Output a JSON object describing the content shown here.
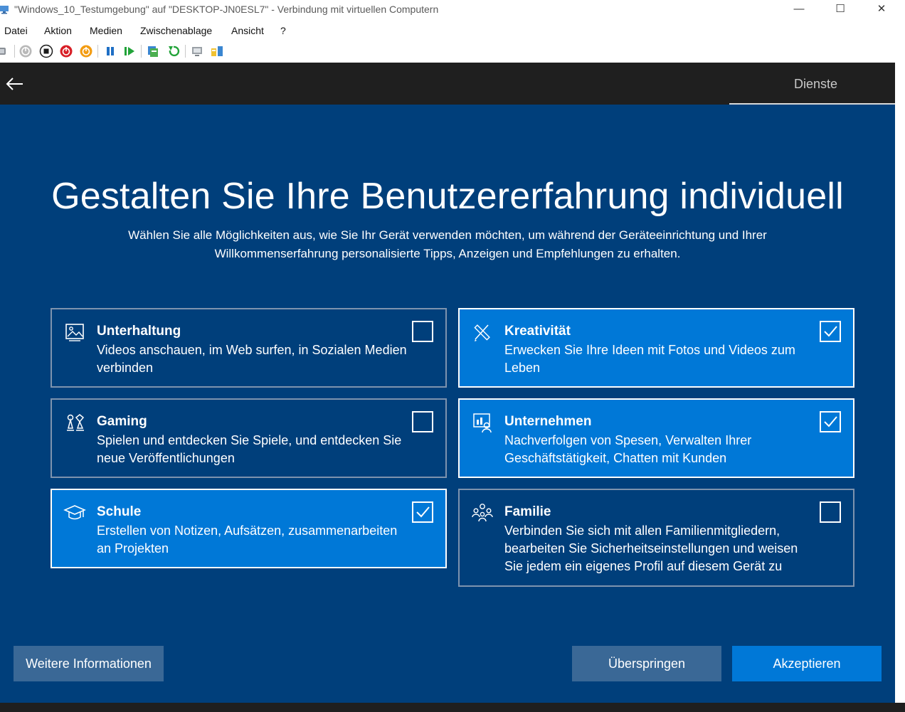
{
  "window": {
    "title": "\"Windows_10_Testumgebung\" auf \"DESKTOP-JN0ESL7\" - Verbindung mit virtuellen Computern",
    "minimize_glyph": "—",
    "maximize_glyph": "☐",
    "close_glyph": "✕"
  },
  "menu": [
    "Datei",
    "Aktion",
    "Medien",
    "Zwischenablage",
    "Ansicht",
    "?"
  ],
  "toolbar": {
    "icons": [
      "ctrl-alt-del-icon",
      "start-icon",
      "turn-off-icon",
      "shut-down-icon",
      "save-icon",
      "pause-icon",
      "resume-icon",
      "checkpoint-icon",
      "revert-icon",
      "enhanced-session-icon",
      "share-icon"
    ]
  },
  "oobe": {
    "back_icon": "back-arrow-icon",
    "stage_label": "Dienste",
    "heading": "Gestalten Sie Ihre Benutzererfahrung individuell",
    "subtitle": "Wählen Sie alle Möglichkeiten aus, wie Sie Ihr Gerät verwenden möchten, um während der Geräteeinrichtung und Ihrer Willkommenserfahrung personalisierte Tipps, Anzeigen und Empfehlungen zu erhalten.",
    "cards": [
      {
        "title": "Unterhaltung",
        "description": "Videos anschauen, im Web surfen, in Sozialen Medien verbinden",
        "checked": false,
        "icon": "picture-icon"
      },
      {
        "title": "Kreativität",
        "description": "Erwecken Sie Ihre Ideen mit Fotos und Videos zum Leben",
        "checked": true,
        "icon": "pen-ruler-icon"
      },
      {
        "title": "Gaming",
        "description": "Spielen und entdecken Sie Spiele, und entdecken Sie neue Veröffentlichungen",
        "checked": false,
        "icon": "game-pieces-icon"
      },
      {
        "title": "Unternehmen",
        "description": "Nachverfolgen von Spesen, Verwalten Ihrer Geschäftstätigkeit, Chatten mit Kunden",
        "checked": true,
        "icon": "business-chart-icon"
      },
      {
        "title": "Schule",
        "description": "Erstellen von Notizen, Aufsätzen, zusammenarbeiten an Projekten",
        "checked": true,
        "icon": "graduation-cap-icon"
      },
      {
        "title": "Familie",
        "description": "Verbinden Sie sich mit allen Familienmitgliedern, bearbeiten Sie Sicherheitseinstellungen und weisen Sie jedem ein eigenes Profil auf diesem Gerät zu",
        "checked": false,
        "icon": "family-icon"
      }
    ],
    "buttons": {
      "more_info": "Weitere Informationen",
      "skip": "Überspringen",
      "accept": "Akzeptieren"
    }
  },
  "colors": {
    "oobe_background": "#003f7b",
    "selected_card": "#0078d7",
    "accent_button": "#0078d7",
    "secondary_button": "#3a6896",
    "top_bar": "#1f1f1f"
  }
}
